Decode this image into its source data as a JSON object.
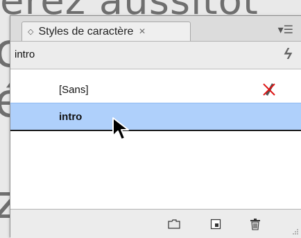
{
  "background_text": {
    "line1": "erez aussitôt",
    "line2": "c",
    "line3": "é",
    "line4": "z"
  },
  "panel": {
    "title": "Styles de caractère",
    "tab_close": "×",
    "current_style": "intro",
    "styles": [
      {
        "label": "[Sans]"
      },
      {
        "label": "intro",
        "selected": true
      }
    ]
  },
  "colors": {
    "selection": "#afd0fb",
    "panel_bg": "#ececec"
  }
}
